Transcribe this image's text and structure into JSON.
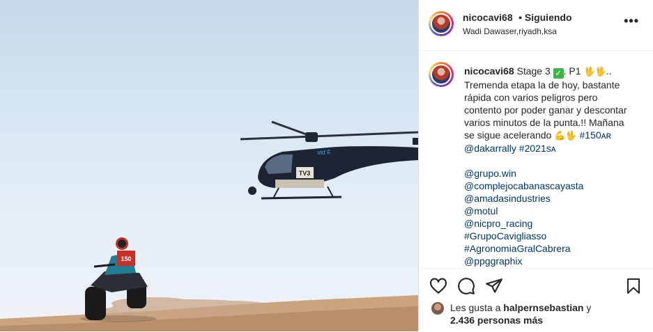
{
  "post": {
    "header": {
      "username": "nicocavi68",
      "follow_status": "• Siguiendo",
      "location": "Wadi Dawaser,riyadh,ksa",
      "more_label": "•••"
    },
    "caption": {
      "username": "nicocavi68",
      "stage_text": "Stage 3",
      "p1_text": ". P1",
      "hands_1": "🖖🖖",
      "dots": "..",
      "lines": [
        "Tremenda etapa la de hoy, bastante",
        "rápida con varios peligros pero",
        "contento por poder ganar y descontar",
        "varios minutos de la punta.!! Mañana"
      ],
      "line_accel": "se sigue acelerando",
      "emoji_accel": "💪🖖",
      "hashtag_150": "#150ᴀʀ",
      "mention_dakar": "@dakarrally",
      "hashtag_2021": "#2021sᴀ",
      "tags": [
        "@grupo.win",
        "@complejocabanascayasta",
        "@amadasindustries",
        "@motul",
        "@nicpro_racing",
        "#GrupoCavigliasso",
        "#AgronomiaGralCabrera",
        "@ppggraphix"
      ]
    },
    "likes": {
      "prefix": "Les gusta a",
      "user": "halpernsebastian",
      "suffix": "y",
      "count_text": "2.436 personas más"
    },
    "photo": {
      "helicopter_tag": "TV3",
      "helicopter_logo": "vid F",
      "quad_number": "150"
    }
  },
  "colors": {
    "link": "#00376b",
    "text": "#262626",
    "border": "#dbdbdb",
    "check": "#3db54a"
  },
  "icons": [
    "more-options-icon",
    "heart-icon",
    "comment-icon",
    "share-icon",
    "bookmark-icon",
    "check-mark-icon"
  ]
}
